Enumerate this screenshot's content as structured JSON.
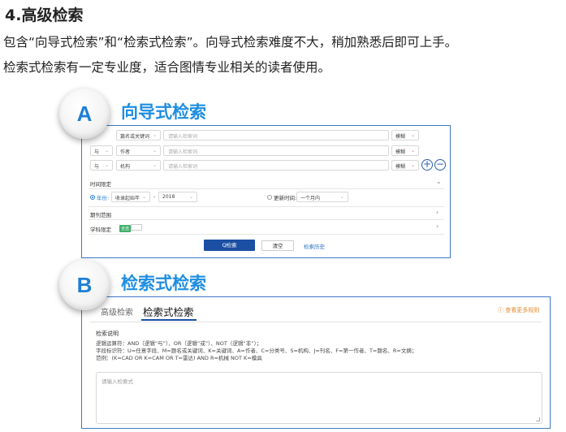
{
  "article": {
    "heading": "4.高级检索",
    "para1": "包含“向导式检索”和“检索式检索”。向导式检索难度不大，稍加熟悉后即可上手。",
    "para2": "检索式检索有一定专业度，适合图情专业相关的读者使用。"
  },
  "section_a": {
    "badge": "A",
    "title": "向导式检索",
    "rows": [
      {
        "logic": "",
        "field": "篇名或关键词",
        "placeholder": "请输入检索词",
        "mode": "模糊"
      },
      {
        "logic": "与",
        "field": "作者",
        "placeholder": "请输入检索词",
        "mode": "模糊"
      },
      {
        "logic": "与",
        "field": "机构",
        "placeholder": "请输入检索词",
        "mode": "模糊"
      }
    ],
    "plus_glyph": "+",
    "minus_glyph": "−",
    "time_limit": "时间限定",
    "year_label": "年份:",
    "year_from": "收录起始年",
    "dash": "-",
    "year_to": "2018",
    "update_label": "更新时间:",
    "update_value": "一个月内",
    "journal_range": "期刊范围",
    "subject_limit": "学科限定",
    "all_tag": "全选",
    "search_button": "Q检索",
    "clear_button": "清空",
    "history_link": "检索历史"
  },
  "section_b": {
    "badge": "B",
    "title": "检索式检索",
    "tabs": [
      "高级检索",
      "检索式检索"
    ],
    "active_tab": 1,
    "rules_link": "ⓘ 查看更多规则",
    "desc_title": "检索说明",
    "desc_lines": [
      "逻辑运算符：AND（逻辑“与”）、OR（逻辑“或”）、NOT（逻辑“非”）；",
      "字段标识符：U=任意字段、M=题名或关键词、K=关键词、A=作者、C=分类号、S=机构、J=刊名、F=第一作者、T=题名、R=文摘；",
      "范例：(K=CAD OR K=CAM OR T=雷达) AND R=机械 NOT K=模具"
    ],
    "textarea_placeholder": "请输入检索式"
  },
  "colors": {
    "accent_blue": "#1f8ee0",
    "panel_border": "#3e79c4",
    "button_blue": "#1b4fa3",
    "rules_orange": "#e48a2e"
  }
}
